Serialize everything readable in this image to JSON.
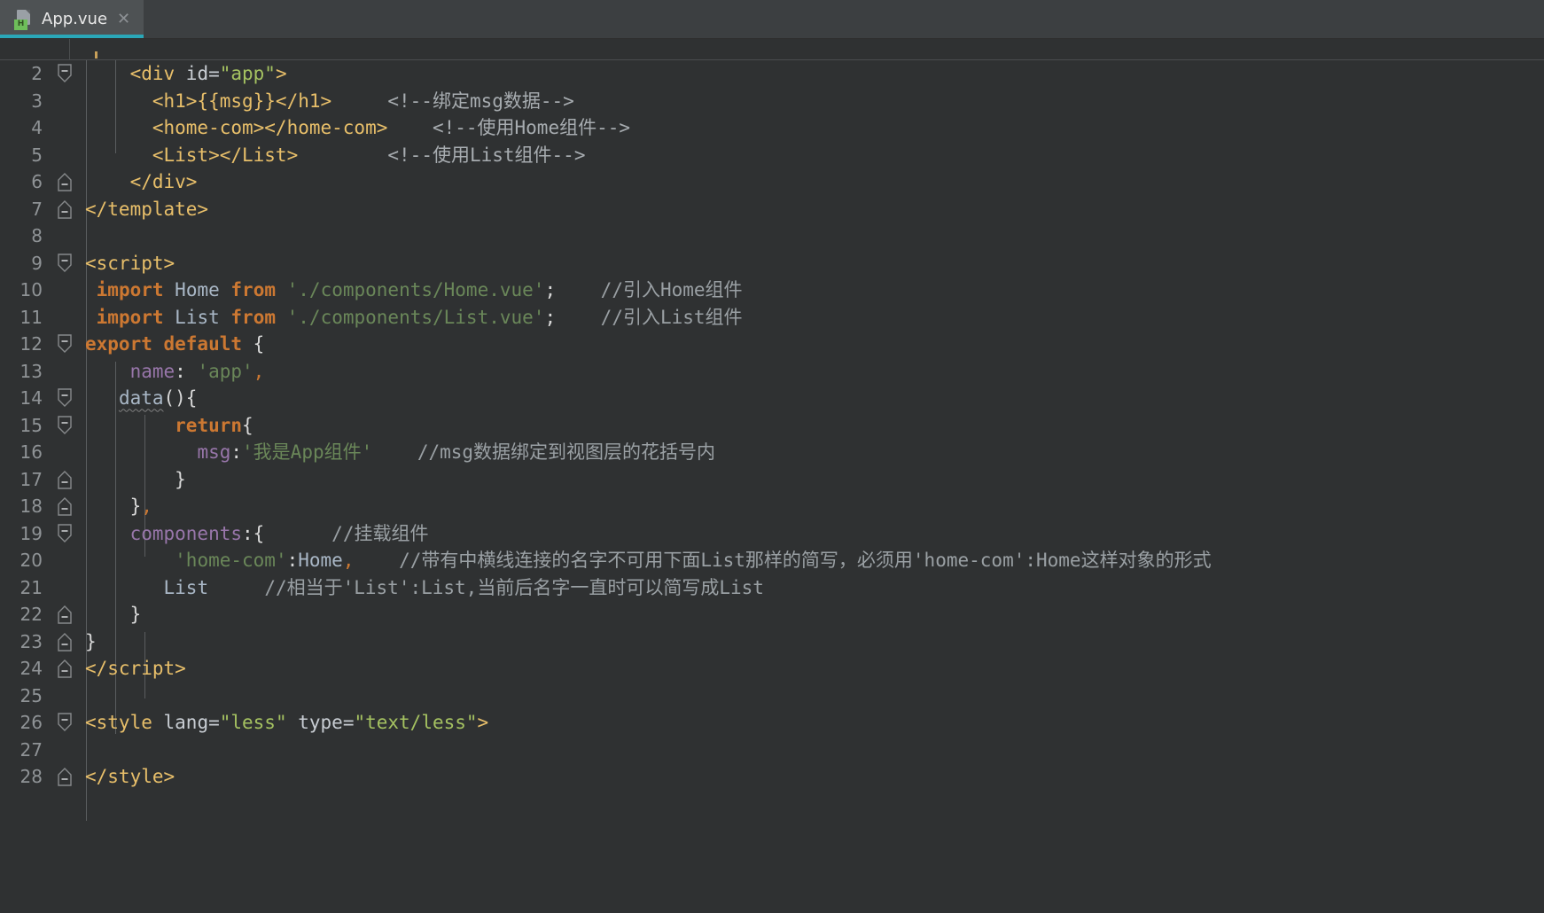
{
  "window": {
    "background": "#2f3132",
    "tabbar_background": "#3c3f41"
  },
  "tab": {
    "title": "App.vue",
    "icon_name": "vue-file-icon",
    "icon_badge": "H",
    "close_label": "✕",
    "active_underline_color": "#2aa7b8"
  },
  "editor": {
    "first_visible_line": 2,
    "last_visible_line": 28,
    "language": "vue",
    "colors": {
      "tag": "#e8bf6a",
      "string": "#6a8759",
      "keyword": "#cc7832",
      "property": "#9876aa",
      "comment": "#9aa0a4",
      "identifier": "#a9b7c6",
      "linenumber": "#8f9396"
    },
    "lines": [
      {
        "no": "2",
        "fold": "open",
        "indent": 1
      },
      {
        "no": "3",
        "fold": "none",
        "indent": 2
      },
      {
        "no": "4",
        "fold": "none",
        "indent": 2
      },
      {
        "no": "5",
        "fold": "none",
        "indent": 2
      },
      {
        "no": "6",
        "fold": "close",
        "indent": 1
      },
      {
        "no": "7",
        "fold": "close",
        "indent": 0
      },
      {
        "no": "8",
        "fold": "none",
        "indent": 0
      },
      {
        "no": "9",
        "fold": "open",
        "indent": 0
      },
      {
        "no": "10",
        "fold": "none",
        "indent": 0
      },
      {
        "no": "11",
        "fold": "none",
        "indent": 0
      },
      {
        "no": "12",
        "fold": "open",
        "indent": 0
      },
      {
        "no": "13",
        "fold": "none",
        "indent": 1
      },
      {
        "no": "14",
        "fold": "open",
        "indent": 1
      },
      {
        "no": "15",
        "fold": "open",
        "indent": 2
      },
      {
        "no": "16",
        "fold": "none",
        "indent": 3
      },
      {
        "no": "17",
        "fold": "close",
        "indent": 2
      },
      {
        "no": "18",
        "fold": "close",
        "indent": 1
      },
      {
        "no": "19",
        "fold": "open",
        "indent": 1
      },
      {
        "no": "20",
        "fold": "none",
        "indent": 2
      },
      {
        "no": "21",
        "fold": "none",
        "indent": 2
      },
      {
        "no": "22",
        "fold": "close",
        "indent": 1
      },
      {
        "no": "23",
        "fold": "close",
        "indent": 0
      },
      {
        "no": "24",
        "fold": "close",
        "indent": 0
      },
      {
        "no": "25",
        "fold": "none",
        "indent": 0
      },
      {
        "no": "26",
        "fold": "open",
        "indent": 0
      },
      {
        "no": "27",
        "fold": "none",
        "indent": 0
      },
      {
        "no": "28",
        "fold": "close",
        "indent": 0
      }
    ],
    "code": {
      "l2": {
        "indent": "    ",
        "tag_open": "<div ",
        "attr": "id=",
        "str": "\"app\"",
        "tag_close": ">"
      },
      "l3": {
        "indent": "      ",
        "tag": "<h1>{{msg}}</h1>",
        "gap": "     ",
        "comment": "<!--绑定msg数据-->"
      },
      "l4": {
        "indent": "      ",
        "tag": "<home-com></home-com>",
        "gap": "    ",
        "comment": "<!--使用Home组件-->"
      },
      "l5": {
        "indent": "      ",
        "tag": "<List></List>",
        "gap": "        ",
        "comment": "<!--使用List组件-->"
      },
      "l6": {
        "indent": "    ",
        "tag": "</div>"
      },
      "l7": {
        "indent": "",
        "tag": "</template>"
      },
      "l8": {
        "text": ""
      },
      "l9": {
        "indent": "",
        "tag": "<script>"
      },
      "l10": {
        "indent": " ",
        "kw1": "import",
        "sp1": " ",
        "id": "Home",
        "sp2": " ",
        "kw2": "from",
        "sp3": " ",
        "str": "'./components/Home.vue'",
        "semi": ";",
        "gap": "    ",
        "comment": "//引入Home组件"
      },
      "l11": {
        "indent": " ",
        "kw1": "import",
        "sp1": " ",
        "id": "List",
        "sp2": " ",
        "kw2": "from",
        "sp3": " ",
        "str": "'./components/List.vue'",
        "semi": ";",
        "gap": "    ",
        "comment": "//引入List组件"
      },
      "l12": {
        "indent": "",
        "kw": "export default",
        "rest": " {"
      },
      "l13": {
        "indent": "    ",
        "prop": "name",
        "colon": ": ",
        "str": "'app'",
        "comma": ","
      },
      "l14": {
        "indent": "   ",
        "fn": "data",
        "rest": "(){"
      },
      "l15": {
        "indent": "        ",
        "kw": "return",
        "rest": "{"
      },
      "l16": {
        "indent": "          ",
        "prop": "msg",
        "colon": ":",
        "str": "'我是App组件'",
        "gap": "    ",
        "comment": "//msg数据绑定到视图层的花括号内"
      },
      "l17": {
        "indent": "        ",
        "text": "}"
      },
      "l18": {
        "indent": "    ",
        "brace": "}",
        "comma": ","
      },
      "l19": {
        "indent": "    ",
        "prop": "components",
        "colon": ":{",
        "gap": "      ",
        "comment": "//挂载组件"
      },
      "l20": {
        "indent": "        ",
        "str": "'home-com'",
        "colon": ":",
        "id": "Home",
        "comma": ",",
        "gap": "    ",
        "comment": "//带有中横线连接的名字不可用下面List那样的简写，必须用'home-com':Home这样对象的形式"
      },
      "l21": {
        "indent": "       ",
        "id": "List",
        "gap": "     ",
        "comment": "//相当于'List':List,当前后名字一直时可以简写成List"
      },
      "l22": {
        "indent": "    ",
        "text": "}"
      },
      "l23": {
        "indent": "",
        "text": "}"
      },
      "l24": {
        "indent": "",
        "tag": "</script>"
      },
      "l25": {
        "text": ""
      },
      "l26": {
        "indent": "",
        "tag_open": "<style ",
        "attr1": "lang=",
        "str1": "\"less\"",
        "sp": " ",
        "attr2": "type=",
        "str2": "\"text/less\"",
        "tag_close": ">"
      },
      "l27": {
        "text": ""
      },
      "l28": {
        "indent": "",
        "tag": "</style>"
      }
    }
  }
}
